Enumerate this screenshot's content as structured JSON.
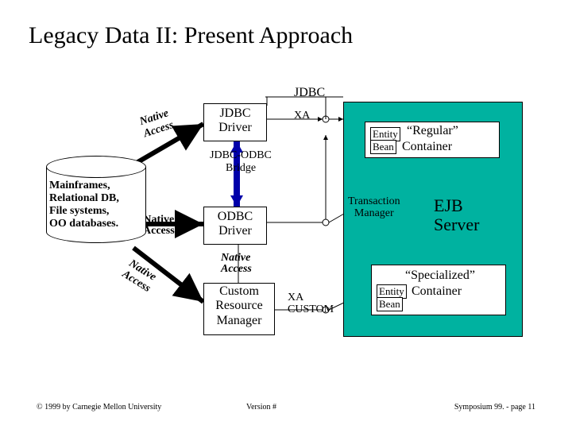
{
  "title": "Legacy Data II: Present Approach",
  "labels": {
    "jdbc_top": "JDBC",
    "jdbc_driver_l1": "JDBC",
    "jdbc_driver_l2": "Driver",
    "bridge_l1": "JDBC-ODBC",
    "bridge_l2": "Bridge",
    "odbc_driver_l1": "ODBC",
    "odbc_driver_l2": "Driver",
    "custom_l1": "Custom",
    "custom_l2": "Resource",
    "custom_l3": "Manager",
    "native_up_l1": "Native",
    "native_up_l2": "Access",
    "native_mid_l1": "Native",
    "native_mid_l2": "Access",
    "native_down_l1": "Native",
    "native_down_l2": "Access",
    "native2_l1": "Native",
    "native2_l2": "Access",
    "xa1": "XA",
    "xa2_l1": "XA",
    "xa2_l2": "CUSTOM"
  },
  "cylinder": {
    "l1": "Mainframes,",
    "l2": "Relational DB,",
    "l3": "File systems,",
    "l4": "OO databases."
  },
  "server": {
    "entity1": "Entity",
    "bean1": "Bean",
    "regular": "“Regular”",
    "container1": "Container",
    "transaction_l1": "Transaction",
    "transaction_l2": "Manager",
    "ejb": "EJB",
    "server_word": "Server",
    "entity2": "Entity",
    "bean2": "Bean",
    "specialized": "“Specialized”",
    "container2": "Container"
  },
  "footer": {
    "left": "© 1999 by Carnegie Mellon University",
    "mid": "Version #",
    "right": "Symposium 99. - page 11"
  }
}
